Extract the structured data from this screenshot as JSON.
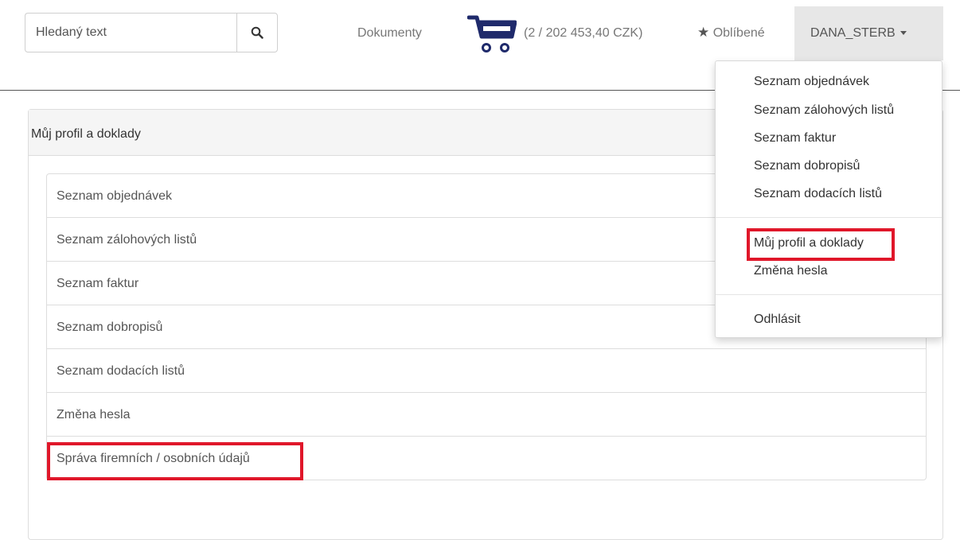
{
  "navbar": {
    "search": {
      "placeholder": "Hledaný text",
      "value": ""
    },
    "documents_label": "Dokumenty",
    "cart_summary": "(2 / 202 453,40 CZK)",
    "favorites_label": "Oblíbené",
    "user_name": "DANA_STERB"
  },
  "panel": {
    "title": "Můj profil a doklady",
    "items": [
      {
        "label": "Seznam objednávek"
      },
      {
        "label": "Seznam zálohových listů"
      },
      {
        "label": "Seznam faktur"
      },
      {
        "label": "Seznam dobropisů"
      },
      {
        "label": "Seznam dodacích listů"
      },
      {
        "label": "Změna hesla"
      },
      {
        "label": "Správa firemních / osobních údajů"
      }
    ]
  },
  "user_menu": {
    "items": [
      {
        "label": "Seznam objednávek"
      },
      {
        "label": "Seznam zálohových listů"
      },
      {
        "label": "Seznam faktur"
      },
      {
        "label": "Seznam dobropisů"
      },
      {
        "label": "Seznam dodacích listů"
      },
      {
        "label": "Můj profil a doklady"
      },
      {
        "label": "Změna hesla"
      },
      {
        "label": "Odhlásit"
      }
    ]
  },
  "colors": {
    "highlight": "#e0172a",
    "cart_icon": "#1f2a6b"
  }
}
